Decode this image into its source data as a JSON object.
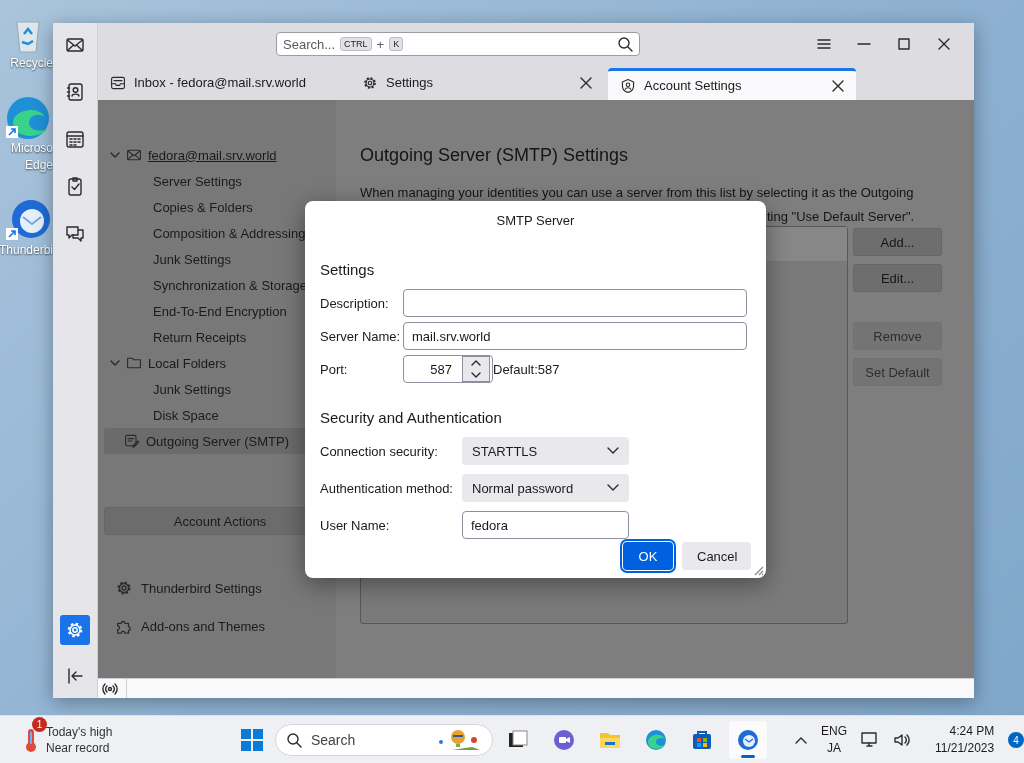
{
  "desktop_icons": [
    {
      "kind": "recycle",
      "lines": [
        "Recycle"
      ]
    },
    {
      "kind": "edge",
      "lines": [
        "Microso",
        "Edge"
      ]
    },
    {
      "kind": "thunderbird",
      "lines": [
        "Thunderbi"
      ]
    }
  ],
  "spaces": [
    {
      "kind": "mail",
      "selected": false
    },
    {
      "kind": "contacts",
      "selected": false
    },
    {
      "kind": "calendar",
      "selected": false
    },
    {
      "kind": "tasks",
      "selected": false
    },
    {
      "kind": "chat",
      "selected": false
    },
    {
      "kind": "settings",
      "selected": true
    }
  ],
  "search": {
    "placeholder": "Search...",
    "keys": [
      "CTRL",
      "K"
    ],
    "joiner": "+"
  },
  "tabs": [
    {
      "kind": "inbox",
      "label": "Inbox - fedora@mail.srv.world",
      "selected": false,
      "closable": false
    },
    {
      "kind": "settings",
      "label": "Settings",
      "selected": false,
      "closable": true
    },
    {
      "kind": "account",
      "label": "Account Settings",
      "selected": true,
      "closable": true
    }
  ],
  "account_tree": [
    {
      "kind": "mail",
      "label": "fedora@mail.srv.world",
      "expanded": true,
      "selected": false,
      "children": [
        {
          "label": "Server Settings",
          "selected": false
        },
        {
          "label": "Copies & Folders",
          "selected": false
        },
        {
          "label": "Composition & Addressing",
          "selected": false
        },
        {
          "label": "Junk Settings",
          "selected": false
        },
        {
          "label": "Synchronization & Storage",
          "selected": false
        },
        {
          "label": "End-To-End Encryption",
          "selected": false
        },
        {
          "label": "Return Receipts",
          "selected": false
        }
      ]
    },
    {
      "kind": "folder",
      "label": "Local Folders",
      "expanded": true,
      "selected": false,
      "children": [
        {
          "label": "Junk Settings",
          "selected": false
        },
        {
          "label": "Disk Space",
          "selected": false
        }
      ]
    },
    {
      "kind": "smtp",
      "label": "Outgoing Server (SMTP)",
      "selected": true
    }
  ],
  "account_actions": {
    "label": "Account Actions"
  },
  "sidebar_links": [
    {
      "kind": "gear",
      "label": "Thunderbird Settings"
    },
    {
      "kind": "puzzle",
      "label": "Add-ons and Themes"
    }
  ],
  "page": {
    "title": "Outgoing Server (SMTP) Settings",
    "intro": "When managing your identities you can use a server from this list by selecting it as the Outgoing",
    "intro_tail": "ting \"Use Default Server\".",
    "server_rows": [
      {
        "selected": true
      }
    ],
    "server_buttons": [
      {
        "label": "Add...",
        "disabled": false
      },
      {
        "label": "Edit...",
        "disabled": false
      },
      {
        "label": "Remove",
        "disabled": true
      },
      {
        "label": "Set Default",
        "disabled": true
      }
    ]
  },
  "dialog": {
    "title": "SMTP Server",
    "sections": [
      {
        "heading": "Settings",
        "fields": [
          {
            "kind": "text",
            "label": "Description:"
          },
          {
            "kind": "text",
            "label": "Server Name:",
            "value": "mail.srv.world"
          },
          {
            "kind": "number",
            "label": "Port:",
            "value": "587",
            "hint": "Default:587"
          }
        ]
      },
      {
        "heading": "Security and Authentication",
        "fields": [
          {
            "kind": "select",
            "label": "Connection security:",
            "value": "STARTTLS"
          },
          {
            "kind": "select",
            "label": "Authentication method:",
            "value": "Normal password"
          },
          {
            "kind": "text",
            "label": "User Name:",
            "value": "fedora"
          }
        ]
      }
    ],
    "buttons": [
      {
        "label": "OK",
        "default": true
      },
      {
        "label": "Cancel",
        "default": false
      }
    ]
  },
  "taskbar": {
    "weather": {
      "badge": "1",
      "title": "Today's high",
      "subtitle": "Near record"
    },
    "search_placeholder": "Search",
    "apps": [
      {
        "kind": "taskview",
        "selected": false
      },
      {
        "kind": "teams",
        "selected": false
      },
      {
        "kind": "explorer",
        "selected": false
      },
      {
        "kind": "edge",
        "selected": false
      },
      {
        "kind": "store",
        "selected": false
      },
      {
        "kind": "thunderbird",
        "selected": true
      }
    ],
    "language": [
      "ENG",
      "JA"
    ],
    "time": "4:24 PM",
    "date": "11/21/2023",
    "notifications": "4"
  }
}
